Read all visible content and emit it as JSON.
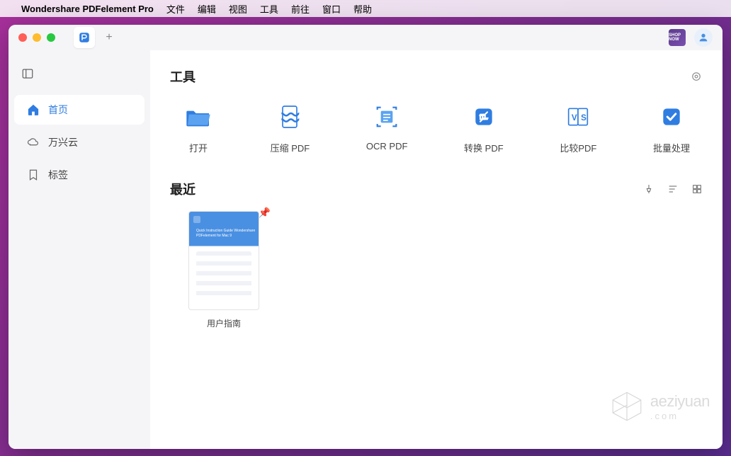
{
  "menubar": {
    "app_name": "Wondershare PDFelement Pro",
    "items": [
      "文件",
      "编辑",
      "视图",
      "工具",
      "前往",
      "窗口",
      "帮助"
    ]
  },
  "titlebar": {
    "shop_badge": "SHOP NOW"
  },
  "sidebar": {
    "items": [
      {
        "label": "首页",
        "icon": "home",
        "active": true
      },
      {
        "label": "万兴云",
        "icon": "cloud",
        "active": false
      },
      {
        "label": "标签",
        "icon": "bookmark",
        "active": false
      }
    ]
  },
  "sections": {
    "tools_title": "工具",
    "recent_title": "最近"
  },
  "tools": [
    {
      "label": "打开",
      "icon": "folder-open"
    },
    {
      "label": "压缩 PDF",
      "icon": "compress"
    },
    {
      "label": "OCR PDF",
      "icon": "ocr"
    },
    {
      "label": "转换 PDF",
      "icon": "convert"
    },
    {
      "label": "比较PDF",
      "icon": "compare"
    },
    {
      "label": "批量处理",
      "icon": "batch"
    }
  ],
  "recent_docs": [
    {
      "name": "用户指南",
      "pinned": true,
      "thumb_title": "Quick Instruction Guide\nWondershare PDFelement\nfor Mac 9"
    }
  ],
  "watermark": {
    "text": "aeziyuan",
    "suffix": ".com"
  }
}
